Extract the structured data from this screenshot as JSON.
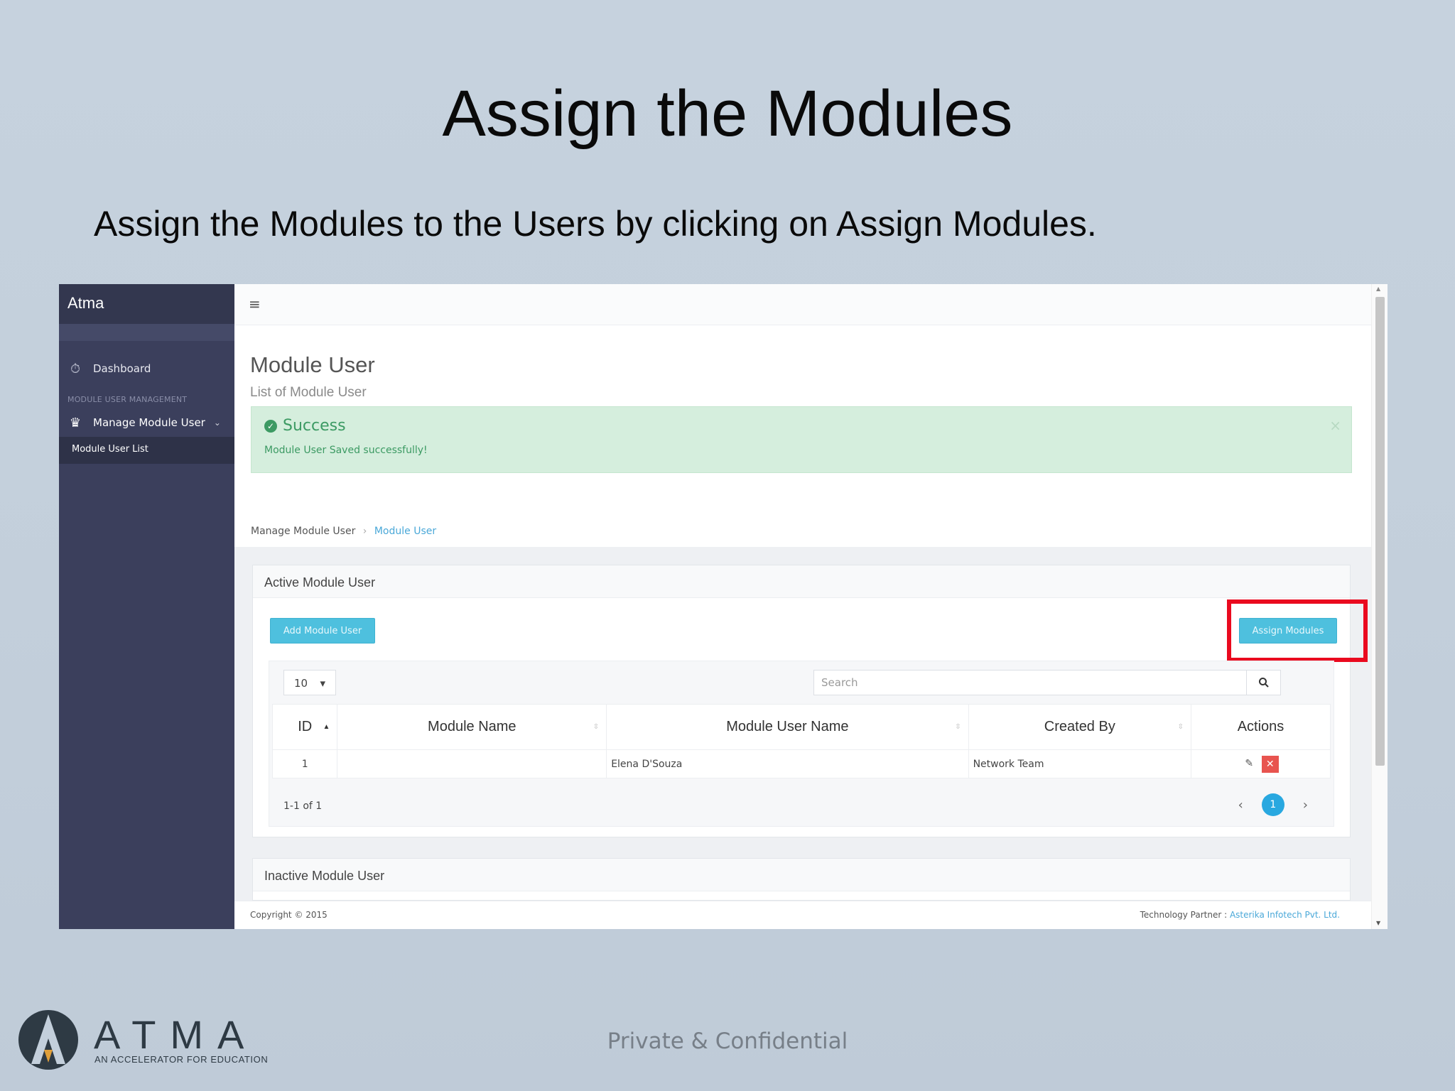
{
  "slide": {
    "title": "Assign the Modules",
    "subtitle": "Assign the Modules to the Users by clicking on Assign Modules.",
    "footer_text": "Private & Confidential",
    "logo": {
      "name": "ATMA",
      "tagline": "AN ACCELERATOR FOR EDUCATION"
    }
  },
  "app": {
    "brand": "Atma",
    "sidebar": {
      "dashboard_label": "Dashboard",
      "section_label": "MODULE USER MANAGEMENT",
      "manage_label": "Manage Module User",
      "sub_item_label": "Module User List"
    },
    "topbar": {
      "menu_icon": "hamburger-icon"
    },
    "page": {
      "title": "Module User",
      "subtitle": "List of Module User"
    },
    "alert": {
      "title": "Success",
      "message": "Module User Saved successfully!",
      "close": "×"
    },
    "breadcrumb": {
      "parent": "Manage Module User",
      "current": "Module User"
    },
    "active_box": {
      "title": "Active Module User",
      "add_button": "Add Module User",
      "assign_button": "Assign Modules",
      "page_size": "10",
      "search_placeholder": "Search",
      "columns": [
        "ID",
        "Module Name",
        "Module User Name",
        "Created By",
        "Actions"
      ],
      "rows": [
        {
          "id": "1",
          "module_name": "",
          "module_user_name": "Elena D'Souza",
          "created_by": "Network Team"
        }
      ],
      "pager_info": "1-1 of 1",
      "current_page": "1"
    },
    "inactive_box": {
      "title": "Inactive Module User"
    },
    "footer": {
      "copyright": "Copyright © 2015",
      "partner_label": "Technology Partner :",
      "partner_name": "Asterika Infotech Pvt. Ltd."
    }
  },
  "colors": {
    "sidebar_bg": "#3b3f5c",
    "accent_button": "#4ec0de",
    "alert_bg": "#d5eedd",
    "highlight_border": "#ea0a1f",
    "delete_button": "#e8544f"
  }
}
